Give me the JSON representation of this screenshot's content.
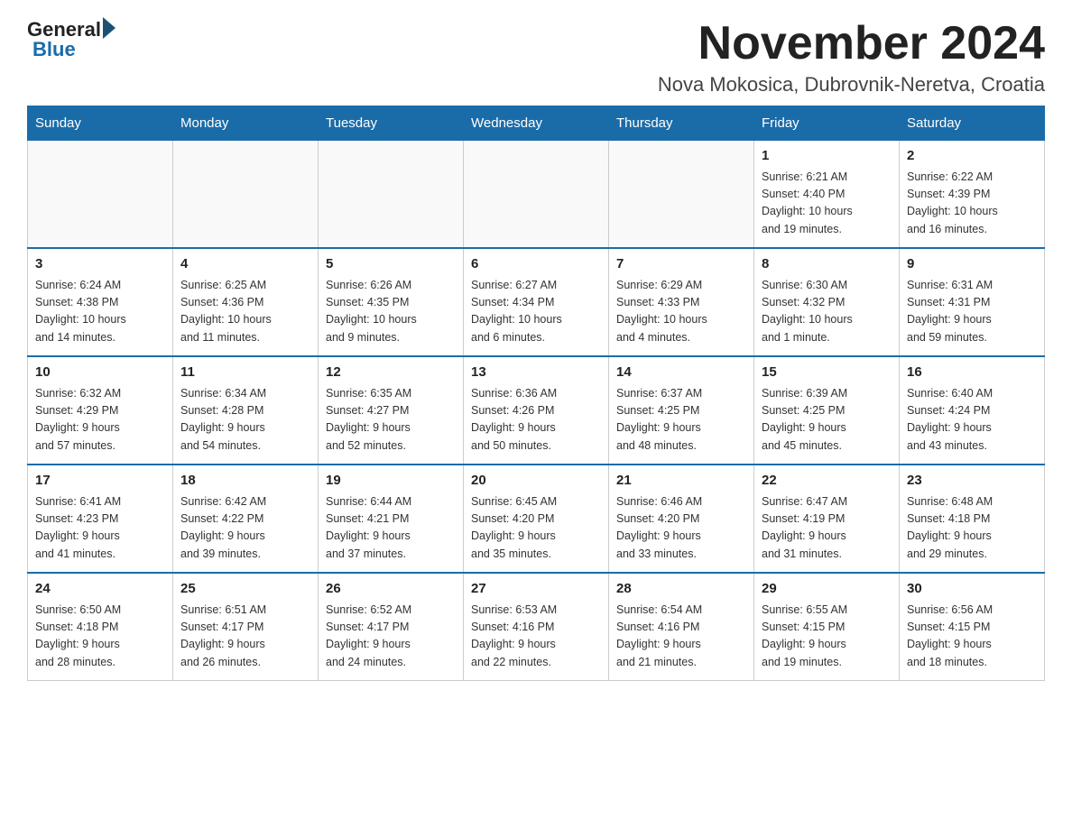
{
  "header": {
    "logo_general": "General",
    "logo_blue": "Blue",
    "month_title": "November 2024",
    "location": "Nova Mokosica, Dubrovnik-Neretva, Croatia"
  },
  "weekdays": [
    "Sunday",
    "Monday",
    "Tuesday",
    "Wednesday",
    "Thursday",
    "Friday",
    "Saturday"
  ],
  "weeks": [
    [
      {
        "day": "",
        "info": ""
      },
      {
        "day": "",
        "info": ""
      },
      {
        "day": "",
        "info": ""
      },
      {
        "day": "",
        "info": ""
      },
      {
        "day": "",
        "info": ""
      },
      {
        "day": "1",
        "info": "Sunrise: 6:21 AM\nSunset: 4:40 PM\nDaylight: 10 hours\nand 19 minutes."
      },
      {
        "day": "2",
        "info": "Sunrise: 6:22 AM\nSunset: 4:39 PM\nDaylight: 10 hours\nand 16 minutes."
      }
    ],
    [
      {
        "day": "3",
        "info": "Sunrise: 6:24 AM\nSunset: 4:38 PM\nDaylight: 10 hours\nand 14 minutes."
      },
      {
        "day": "4",
        "info": "Sunrise: 6:25 AM\nSunset: 4:36 PM\nDaylight: 10 hours\nand 11 minutes."
      },
      {
        "day": "5",
        "info": "Sunrise: 6:26 AM\nSunset: 4:35 PM\nDaylight: 10 hours\nand 9 minutes."
      },
      {
        "day": "6",
        "info": "Sunrise: 6:27 AM\nSunset: 4:34 PM\nDaylight: 10 hours\nand 6 minutes."
      },
      {
        "day": "7",
        "info": "Sunrise: 6:29 AM\nSunset: 4:33 PM\nDaylight: 10 hours\nand 4 minutes."
      },
      {
        "day": "8",
        "info": "Sunrise: 6:30 AM\nSunset: 4:32 PM\nDaylight: 10 hours\nand 1 minute."
      },
      {
        "day": "9",
        "info": "Sunrise: 6:31 AM\nSunset: 4:31 PM\nDaylight: 9 hours\nand 59 minutes."
      }
    ],
    [
      {
        "day": "10",
        "info": "Sunrise: 6:32 AM\nSunset: 4:29 PM\nDaylight: 9 hours\nand 57 minutes."
      },
      {
        "day": "11",
        "info": "Sunrise: 6:34 AM\nSunset: 4:28 PM\nDaylight: 9 hours\nand 54 minutes."
      },
      {
        "day": "12",
        "info": "Sunrise: 6:35 AM\nSunset: 4:27 PM\nDaylight: 9 hours\nand 52 minutes."
      },
      {
        "day": "13",
        "info": "Sunrise: 6:36 AM\nSunset: 4:26 PM\nDaylight: 9 hours\nand 50 minutes."
      },
      {
        "day": "14",
        "info": "Sunrise: 6:37 AM\nSunset: 4:25 PM\nDaylight: 9 hours\nand 48 minutes."
      },
      {
        "day": "15",
        "info": "Sunrise: 6:39 AM\nSunset: 4:25 PM\nDaylight: 9 hours\nand 45 minutes."
      },
      {
        "day": "16",
        "info": "Sunrise: 6:40 AM\nSunset: 4:24 PM\nDaylight: 9 hours\nand 43 minutes."
      }
    ],
    [
      {
        "day": "17",
        "info": "Sunrise: 6:41 AM\nSunset: 4:23 PM\nDaylight: 9 hours\nand 41 minutes."
      },
      {
        "day": "18",
        "info": "Sunrise: 6:42 AM\nSunset: 4:22 PM\nDaylight: 9 hours\nand 39 minutes."
      },
      {
        "day": "19",
        "info": "Sunrise: 6:44 AM\nSunset: 4:21 PM\nDaylight: 9 hours\nand 37 minutes."
      },
      {
        "day": "20",
        "info": "Sunrise: 6:45 AM\nSunset: 4:20 PM\nDaylight: 9 hours\nand 35 minutes."
      },
      {
        "day": "21",
        "info": "Sunrise: 6:46 AM\nSunset: 4:20 PM\nDaylight: 9 hours\nand 33 minutes."
      },
      {
        "day": "22",
        "info": "Sunrise: 6:47 AM\nSunset: 4:19 PM\nDaylight: 9 hours\nand 31 minutes."
      },
      {
        "day": "23",
        "info": "Sunrise: 6:48 AM\nSunset: 4:18 PM\nDaylight: 9 hours\nand 29 minutes."
      }
    ],
    [
      {
        "day": "24",
        "info": "Sunrise: 6:50 AM\nSunset: 4:18 PM\nDaylight: 9 hours\nand 28 minutes."
      },
      {
        "day": "25",
        "info": "Sunrise: 6:51 AM\nSunset: 4:17 PM\nDaylight: 9 hours\nand 26 minutes."
      },
      {
        "day": "26",
        "info": "Sunrise: 6:52 AM\nSunset: 4:17 PM\nDaylight: 9 hours\nand 24 minutes."
      },
      {
        "day": "27",
        "info": "Sunrise: 6:53 AM\nSunset: 4:16 PM\nDaylight: 9 hours\nand 22 minutes."
      },
      {
        "day": "28",
        "info": "Sunrise: 6:54 AM\nSunset: 4:16 PM\nDaylight: 9 hours\nand 21 minutes."
      },
      {
        "day": "29",
        "info": "Sunrise: 6:55 AM\nSunset: 4:15 PM\nDaylight: 9 hours\nand 19 minutes."
      },
      {
        "day": "30",
        "info": "Sunrise: 6:56 AM\nSunset: 4:15 PM\nDaylight: 9 hours\nand 18 minutes."
      }
    ]
  ]
}
